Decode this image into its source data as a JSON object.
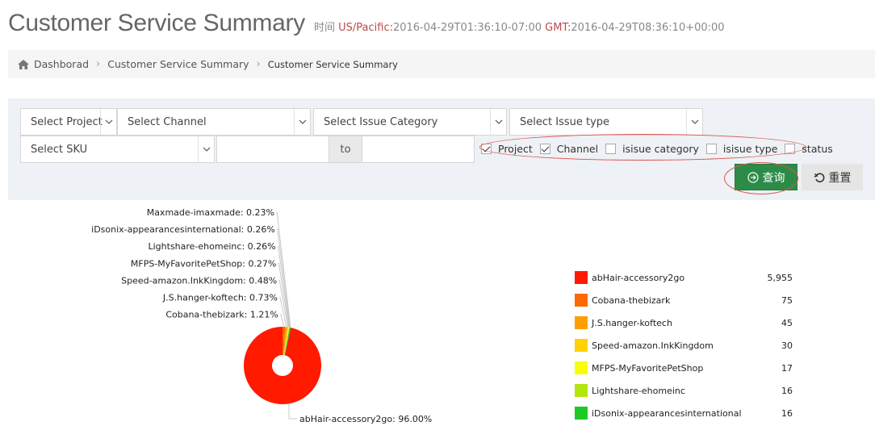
{
  "header": {
    "title": "Customer Service Summary",
    "time_label": "时间",
    "tz_local": "US/Pacific:",
    "time_local": "2016-04-29T01:36:10-07:00",
    "tz_gmt": "GMT:",
    "time_gmt": "2016-04-29T08:36:10+00:00"
  },
  "breadcrumb": {
    "icon": "home-icon",
    "items": [
      "Dashborad",
      "Customer Service Summary",
      "Customer Service Summary"
    ]
  },
  "filters": {
    "project": "Select Project",
    "channel": "Select Channel",
    "issue_category": "Select Issue Category",
    "issue_type": "Select Issue type",
    "sku": "Select SKU",
    "range_from": "",
    "range_to_label": "to",
    "range_to": ""
  },
  "group_by": [
    {
      "label": "Project",
      "checked": true
    },
    {
      "label": "Channel",
      "checked": true
    },
    {
      "label": "isisue category",
      "checked": false
    },
    {
      "label": "isisue type",
      "checked": false
    },
    {
      "label": "status",
      "checked": false
    }
  ],
  "buttons": {
    "query": "查询",
    "reset": "重置"
  },
  "colors": {
    "accent_green": "#2c8c47",
    "annotation_red": "#d9534f"
  },
  "chart_data": {
    "type": "pie",
    "style": "donut",
    "slices": [
      {
        "name": "abHair-accessory2go",
        "percent_label": "96.00%",
        "value": 5955,
        "value_label": "5,955",
        "color": "#ff1a00"
      },
      {
        "name": "Cobana-thebizark",
        "percent_label": "1.21%",
        "value": 75,
        "value_label": "75",
        "color": "#ff6a00"
      },
      {
        "name": "J.S.hanger-koftech",
        "percent_label": "0.73%",
        "value": 45,
        "value_label": "45",
        "color": "#ff9e00"
      },
      {
        "name": "Speed-amazon.InkKingdom",
        "percent_label": "0.48%",
        "value": 30,
        "value_label": "30",
        "color": "#ffd200"
      },
      {
        "name": "MFPS-MyFavoritePetShop",
        "percent_label": "0.27%",
        "value": 17,
        "value_label": "17",
        "color": "#f8ff00"
      },
      {
        "name": "Lightshare-ehomeinc",
        "percent_label": "0.26%",
        "value": 16,
        "value_label": "16",
        "color": "#b3e60d"
      },
      {
        "name": "iDsonix-appearancesinternational",
        "percent_label": "0.26%",
        "value": 16,
        "value_label": "16",
        "color": "#1ec926"
      },
      {
        "name": "Maxmade-imaxmade",
        "percent_label": "0.23%",
        "value": null,
        "value_label": null,
        "color": "#0aa84a"
      }
    ],
    "legend_placement": "right"
  }
}
